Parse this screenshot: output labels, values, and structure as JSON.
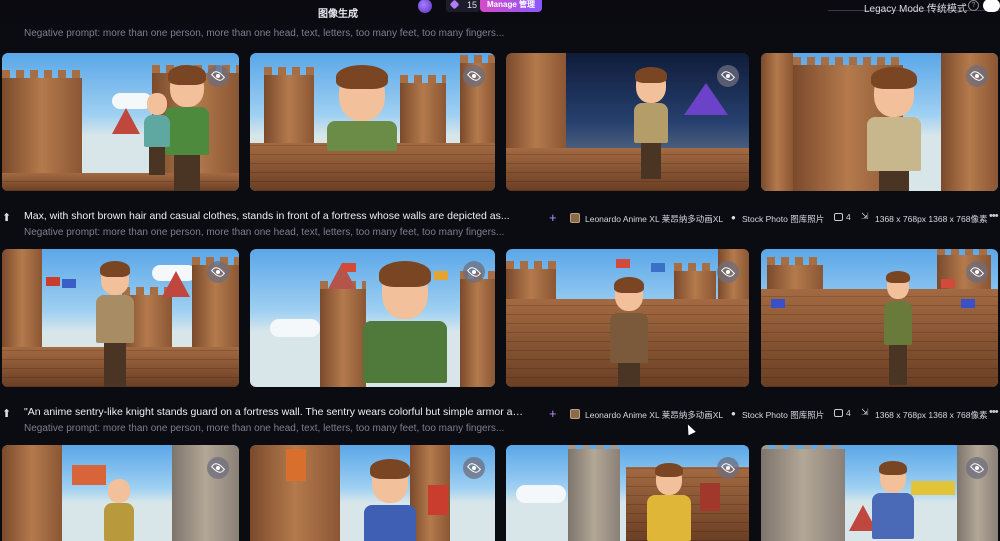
{
  "topbar": {
    "title": "图像生成",
    "credits": "15",
    "manage_label": "Manage 管理",
    "legacy_mode": "Legacy Mode 传统模式",
    "info": "?"
  },
  "prompt_rows": [
    {
      "prompt": "",
      "negative": "Negative prompt: more than one person, more than one head, text, letters, too many feet, too many fingers..."
    },
    {
      "prompt": "Max, with short brown hair and casual clothes, stands in front of a fortress whose walls are depicted as...",
      "negative": "Negative prompt: more than one person, more than one head, text, letters, too many feet, too many fingers...",
      "model": "Leonardo Anime XL 莱昂纳多动画XL",
      "style": "Stock Photo 图库照片",
      "count": "4",
      "size": "1368 x 768px 1368 x 768像素"
    },
    {
      "prompt": "\"An anime sentry-like knight stands guard on a fortress wall. The sentry wears colorful but simple armor an...",
      "negative": "Negative prompt: more than one person, more than one head, text, letters, too many feet, too many fingers...",
      "model": "Leonardo Anime XL 莱昂纳多动画XL",
      "style": "Stock Photo 图库照片",
      "count": "4",
      "size": "1368 x 768px 1368 x 768像素"
    }
  ],
  "icons": {
    "upload": "arrow-up-icon",
    "add": "plus-icon",
    "view": "eye-icon",
    "more": "more-dots-icon"
  },
  "colors": {
    "background": "#0b0b12",
    "accent": "#b48cff",
    "manage_gradient_start": "#d44bc7",
    "manage_gradient_end": "#8a58ff"
  }
}
